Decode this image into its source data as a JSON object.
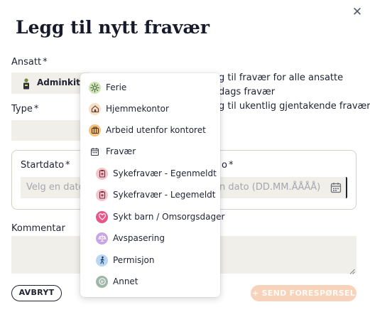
{
  "dialog": {
    "title": "Legg til nytt fravær",
    "close_glyph": "✕"
  },
  "employee": {
    "label": "Ansatt",
    "required_mark": "*",
    "selected_name": "Adminkit De"
  },
  "options": {
    "all_employees": "g til fravær for alle ansatte",
    "full_day": "dags fravær",
    "weekly_recurring": "g til ukentlig gjentakende fravær"
  },
  "type": {
    "label": "Type",
    "required_mark": "*"
  },
  "dates": {
    "start_label": "Startdato",
    "start_required": "*",
    "start_placeholder": "Velg en dato (",
    "end_label": "o",
    "end_required": "*",
    "end_placeholder": "n dato (DD.MM.ÅÅÅÅ)"
  },
  "comment": {
    "label": "Kommentar"
  },
  "buttons": {
    "cancel": "AVBRYT",
    "send": "+ SEND FORESPØRSEL"
  },
  "type_menu": {
    "items": [
      {
        "label": "Ferie",
        "icon": "sun-icon",
        "color": "#cfe3b9"
      },
      {
        "label": "Hjemmekontor",
        "icon": "home-icon",
        "color": "#f6dfc6"
      },
      {
        "label": "Arbeid utenfor kontoret",
        "icon": "briefcase-icon",
        "color": "#f4c27a"
      },
      {
        "label": "Fravær",
        "icon": "calendar-icon",
        "color": "#ffffff"
      },
      {
        "label": "Sykefravær - Egenmeldt",
        "icon": "clipboard-icon",
        "color": "#f2c6cf"
      },
      {
        "label": "Sykefravær - Legemeldt",
        "icon": "clipboard-icon",
        "color": "#f2c6cf"
      },
      {
        "label": "Sykt barn / Omsorgsdager",
        "icon": "heart-icon",
        "color": "#e7578a"
      },
      {
        "label": "Avspasering",
        "icon": "balance-icon",
        "color": "#c9a5e3"
      },
      {
        "label": "Permisjon",
        "icon": "walking-icon",
        "color": "#b9d6f4"
      },
      {
        "label": "Annet",
        "icon": "chat-icon",
        "color": "#9fb7a9"
      }
    ]
  }
}
